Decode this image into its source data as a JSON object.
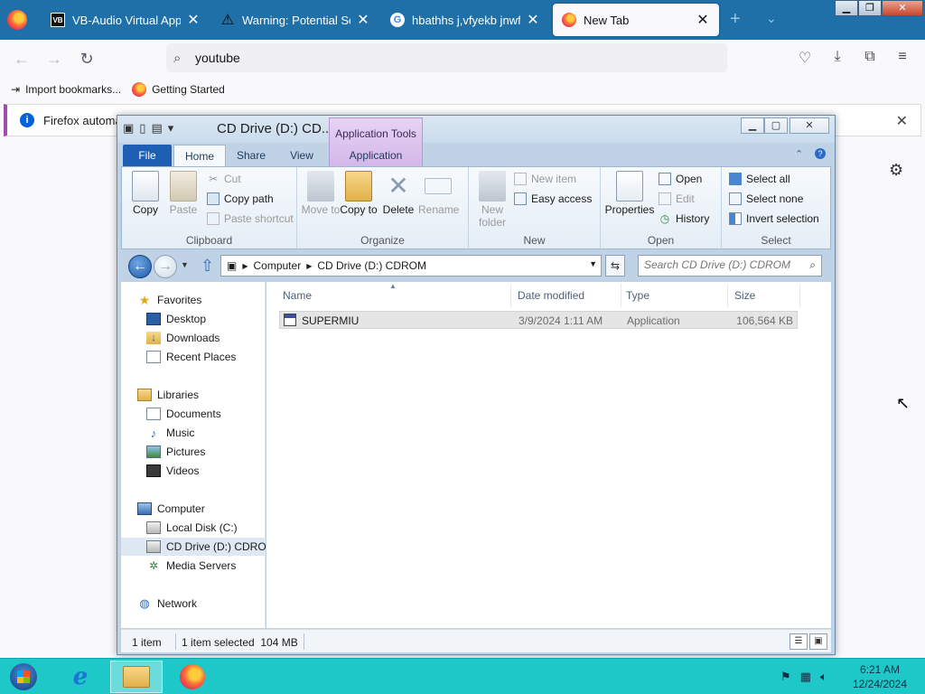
{
  "browser": {
    "tabs": [
      {
        "title": "VB-Audio Virtual Apps",
        "icon": "vb-audio-icon",
        "active": false
      },
      {
        "title": "Warning: Potential Secu",
        "icon": "warning-icon",
        "active": false
      },
      {
        "title": "hbathhs j,vfyekb jnwf yf",
        "icon": "google-icon",
        "active": false
      },
      {
        "title": "New Tab",
        "icon": "firefox-icon",
        "active": true
      }
    ],
    "url_value": "youtube",
    "bookmarks": [
      {
        "label": "Import bookmarks...",
        "icon": "import-icon"
      },
      {
        "label": "Getting Started",
        "icon": "firefox-icon"
      }
    ],
    "infobar_text": "Firefox automati"
  },
  "explorer": {
    "title": "CD Drive (D:) CD...",
    "contextual_tab": "Application Tools",
    "ribbon_tabs": [
      "File",
      "Home",
      "Share",
      "View",
      "Application"
    ],
    "groups": {
      "clipboard": {
        "label": "Clipboard",
        "copy": "Copy",
        "paste": "Paste",
        "cut": "Cut",
        "copy_path": "Copy path",
        "paste_shortcut": "Paste shortcut"
      },
      "organize": {
        "label": "Organize",
        "move_to": "Move to",
        "copy_to": "Copy to",
        "delete": "Delete",
        "rename": "Rename"
      },
      "new": {
        "label": "New",
        "new_folder": "New folder",
        "new_item": "New item",
        "easy_access": "Easy access"
      },
      "open": {
        "label": "Open",
        "properties": "Properties",
        "open": "Open",
        "edit": "Edit",
        "history": "History"
      },
      "select": {
        "label": "Select",
        "select_all": "Select all",
        "select_none": "Select none",
        "invert_selection": "Invert selection"
      }
    },
    "address": {
      "segments": [
        "Computer",
        "CD Drive (D:) CDROM"
      ],
      "search_placeholder": "Search CD Drive (D:) CDROM"
    },
    "nav_pane": {
      "favorites": "Favorites",
      "desktop": "Desktop",
      "downloads": "Downloads",
      "recent_places": "Recent Places",
      "libraries": "Libraries",
      "documents": "Documents",
      "music": "Music",
      "pictures": "Pictures",
      "videos": "Videos",
      "computer": "Computer",
      "local_disk": "Local Disk (C:)",
      "cd_drive": "CD Drive (D:) CDROM",
      "media_servers": "Media Servers",
      "network": "Network"
    },
    "columns": [
      "Name",
      "Date modified",
      "Type",
      "Size"
    ],
    "files": [
      {
        "name": "SUPERMIU",
        "date_modified": "3/9/2024 1:11 AM",
        "type": "Application",
        "size": "106,564 KB"
      }
    ],
    "status": {
      "item_count": "1 item",
      "selection": "1 item selected  104 MB"
    }
  },
  "taskbar": {
    "time": "6:21 AM",
    "date": "12/24/2024"
  },
  "colors": {
    "firefox_tabbar": "#1f6fa8",
    "taskbar": "#1ec8c8",
    "file_tab": "#1e5eb3",
    "contextual_tab": "#d2b6e8"
  }
}
